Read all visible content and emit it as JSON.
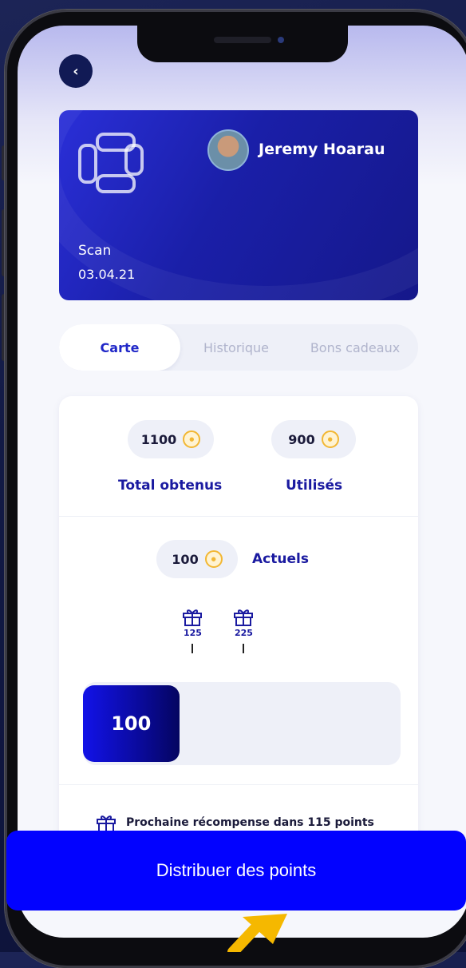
{
  "header": {
    "back_icon": "chevron-left-icon"
  },
  "card": {
    "name": "Jeremy Hoarau",
    "scan_label": "Scan",
    "date": "03.04.21",
    "logo_icon": "brand-logo-icon",
    "avatar_icon": "user-avatar"
  },
  "tabs": [
    {
      "label": "Carte",
      "active": true
    },
    {
      "label": "Historique",
      "active": false
    },
    {
      "label": "Bons cadeaux",
      "active": false
    }
  ],
  "stats": {
    "total_value": "1100",
    "total_label": "Total obtenus",
    "used_value": "900",
    "used_label": "Utilisés",
    "current_value": "100",
    "current_label": "Actuels",
    "coin_icon": "coin-icon"
  },
  "rewards": {
    "milestones": [
      {
        "value": "125",
        "icon": "gift-icon"
      },
      {
        "value": "225",
        "icon": "gift-icon"
      }
    ],
    "progress_value": "100",
    "next_reward_text": "Prochaine récompense dans 115 points"
  },
  "cta": {
    "label": "Distribuer des points"
  },
  "colors": {
    "accent": "#2027c8",
    "cta": "#0202ff",
    "coin": "#f2b733",
    "arrow": "#f5b800"
  }
}
